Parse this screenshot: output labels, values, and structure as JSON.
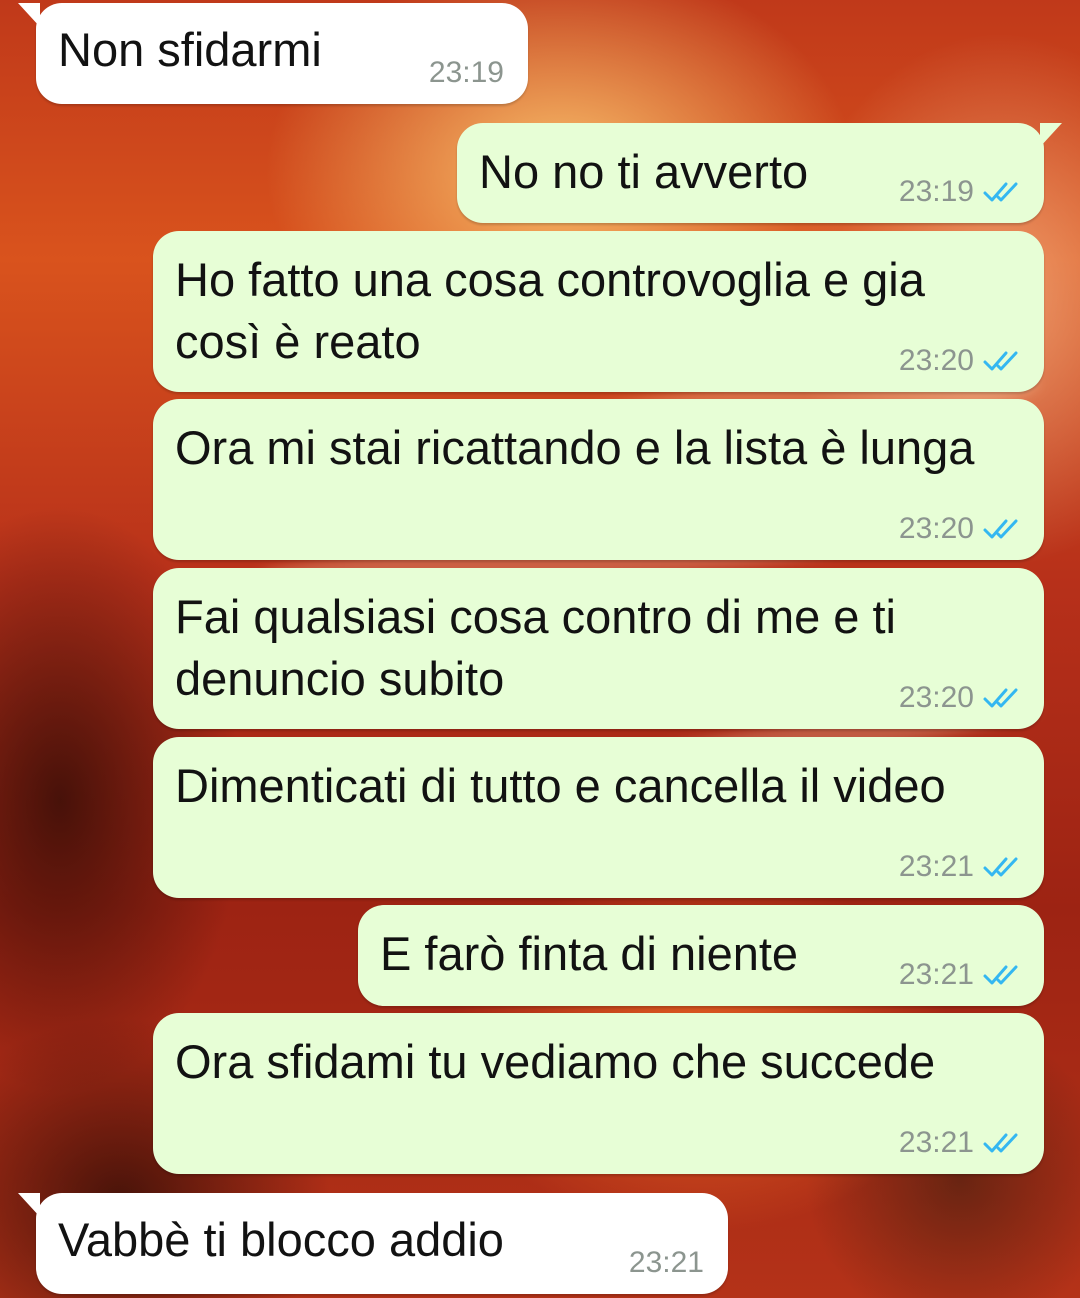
{
  "conversation": {
    "messages": [
      {
        "direction": "in",
        "text": "Non sfidarmi",
        "time": "23:19"
      },
      {
        "direction": "out",
        "text": "No no ti avverto",
        "time": "23:19",
        "status": "read-double-tick-icon"
      },
      {
        "direction": "out",
        "text": "Ho fatto una cosa controvoglia e gia così è reato",
        "time": "23:20",
        "status": "read-double-tick-icon"
      },
      {
        "direction": "out",
        "text": "Ora mi stai ricattando e la lista è lunga",
        "time": "23:20",
        "status": "read-double-tick-icon"
      },
      {
        "direction": "out",
        "text": "Fai qualsiasi cosa contro di me e ti denuncio subito",
        "time": "23:20",
        "status": "read-double-tick-icon"
      },
      {
        "direction": "out",
        "text": "Dimenticati di tutto e cancella il video",
        "time": "23:21",
        "status": "read-double-tick-icon"
      },
      {
        "direction": "out",
        "text": "E farò finta di niente",
        "time": "23:21",
        "status": "read-double-tick-icon"
      },
      {
        "direction": "out",
        "text": "Ora sfidami tu vediamo che succede",
        "time": "23:21",
        "status": "read-double-tick-icon"
      },
      {
        "direction": "in",
        "text": "Vabbè ti blocco addio",
        "time": "23:21"
      }
    ]
  },
  "colors": {
    "incoming_bubble": "#ffffff",
    "outgoing_bubble": "#e7fed6",
    "read_tick": "#34b7f1",
    "timestamp": "#8c958f"
  }
}
